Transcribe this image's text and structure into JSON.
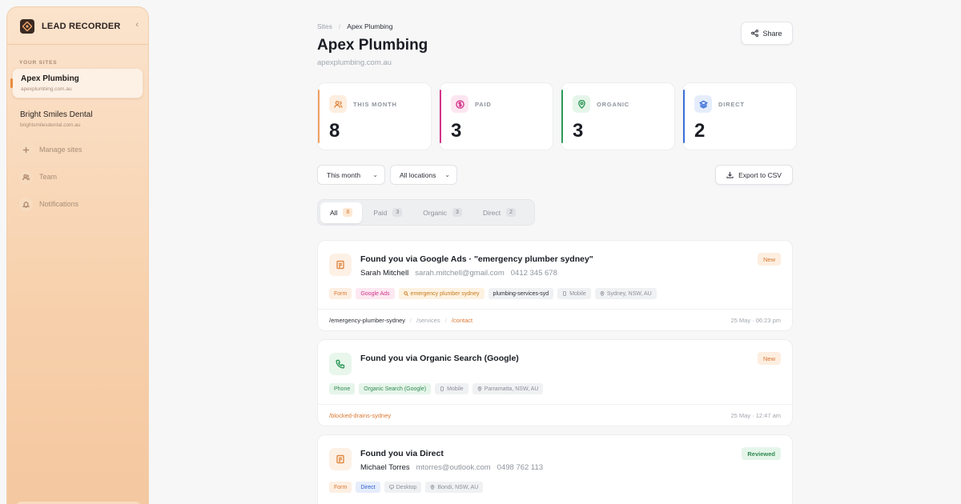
{
  "sidebar": {
    "brand": "LEAD RECORDER",
    "collapse_icon": "chevron-left-icon",
    "section_label": "YOUR SITES",
    "sites": [
      {
        "name": "Apex Plumbing",
        "url": "apexplumbing.com.au",
        "active": true
      },
      {
        "name": "Bright Smiles Dental",
        "url": "brightsmilesdental.com.au",
        "active": false
      }
    ],
    "nav": [
      {
        "label": "Manage sites",
        "icon": "plus-icon"
      },
      {
        "label": "Team",
        "icon": "users-icon"
      },
      {
        "label": "Notifications",
        "icon": "bell-icon"
      }
    ]
  },
  "breadcrumb": {
    "root": "Sites",
    "current": "Apex Plumbing"
  },
  "page": {
    "title": "Apex Plumbing",
    "subtitle": "apexplumbing.com.au",
    "share_label": "Share"
  },
  "stats": [
    {
      "label": "THIS MONTH",
      "value": "8",
      "color": "#f0a060",
      "icon": "users-icon"
    },
    {
      "label": "PAID",
      "value": "3",
      "color": "#d2358a",
      "icon": "dollar-icon"
    },
    {
      "label": "ORGANIC",
      "value": "3",
      "color": "#2f9a5a",
      "icon": "location-pin-icon"
    },
    {
      "label": "DIRECT",
      "value": "2",
      "color": "#3b6fd8",
      "icon": "layers-icon"
    }
  ],
  "filters": {
    "period": "This month",
    "location": "All locations",
    "export_label": "Export to CSV"
  },
  "tabs": [
    {
      "label": "All",
      "count": "8",
      "active": true
    },
    {
      "label": "Paid",
      "count": "3",
      "active": false
    },
    {
      "label": "Organic",
      "count": "3",
      "active": false
    },
    {
      "label": "Direct",
      "count": "2",
      "active": false
    }
  ],
  "leads": [
    {
      "headline": "Found you via Google Ads · \"emergency plumber sydney\"",
      "name": "Sarah Mitchell",
      "email": "sarah.mitchell@gmail.com",
      "phone": "0412 345 678",
      "status": "New",
      "tags": [
        "Form",
        "Google Ads",
        "emergency plumber sydney",
        "plumbing-services-syd",
        "Mobile",
        "Sydney, NSW, AU"
      ],
      "paths": [
        "/emergency-plumber-sydney",
        "/services",
        "/contact"
      ],
      "time": "25 May · 06:23 pm"
    },
    {
      "headline": "Found you via Organic Search (Google)",
      "status": "New",
      "tags": [
        "Phone",
        "Organic Search (Google)",
        "Mobile",
        "Parramatta, NSW, AU"
      ],
      "paths": [
        "/blocked-drains-sydney"
      ],
      "time": "25 May · 12:47 am"
    },
    {
      "headline": "Found you via Direct",
      "name": "Michael Torres",
      "email": "mtorres@outlook.com",
      "phone": "0498 762 113",
      "status": "Reviewed",
      "tags": [
        "Form",
        "Direct",
        "Desktop",
        "Bondi, NSW, AU"
      ]
    }
  ]
}
